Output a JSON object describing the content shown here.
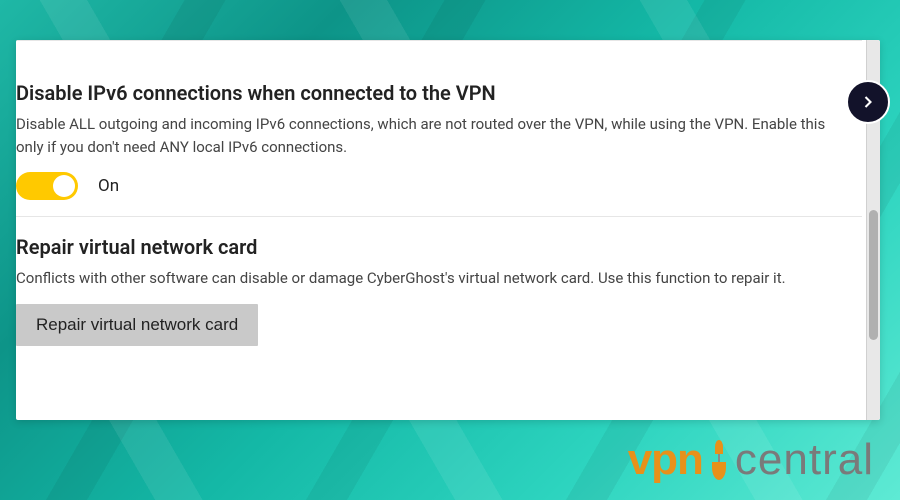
{
  "sections": {
    "ipv6": {
      "title": "Disable IPv6 connections when connected to the VPN",
      "description": "Disable ALL outgoing and incoming IPv6 connections, which are not routed over the VPN, while using the VPN. Enable this only if you don't need ANY local IPv6 connections.",
      "toggle_state": "On"
    },
    "repair": {
      "title": "Repair virtual network card",
      "description": "Conflicts with other software can disable or damage CyberGhost's virtual network card. Use this function to repair it.",
      "button_label": "Repair virtual network card"
    }
  },
  "watermark": {
    "left": "vpn",
    "right": "central"
  },
  "colors": {
    "toggle_on": "#ffc900",
    "brand_orange": "#e8911a"
  }
}
